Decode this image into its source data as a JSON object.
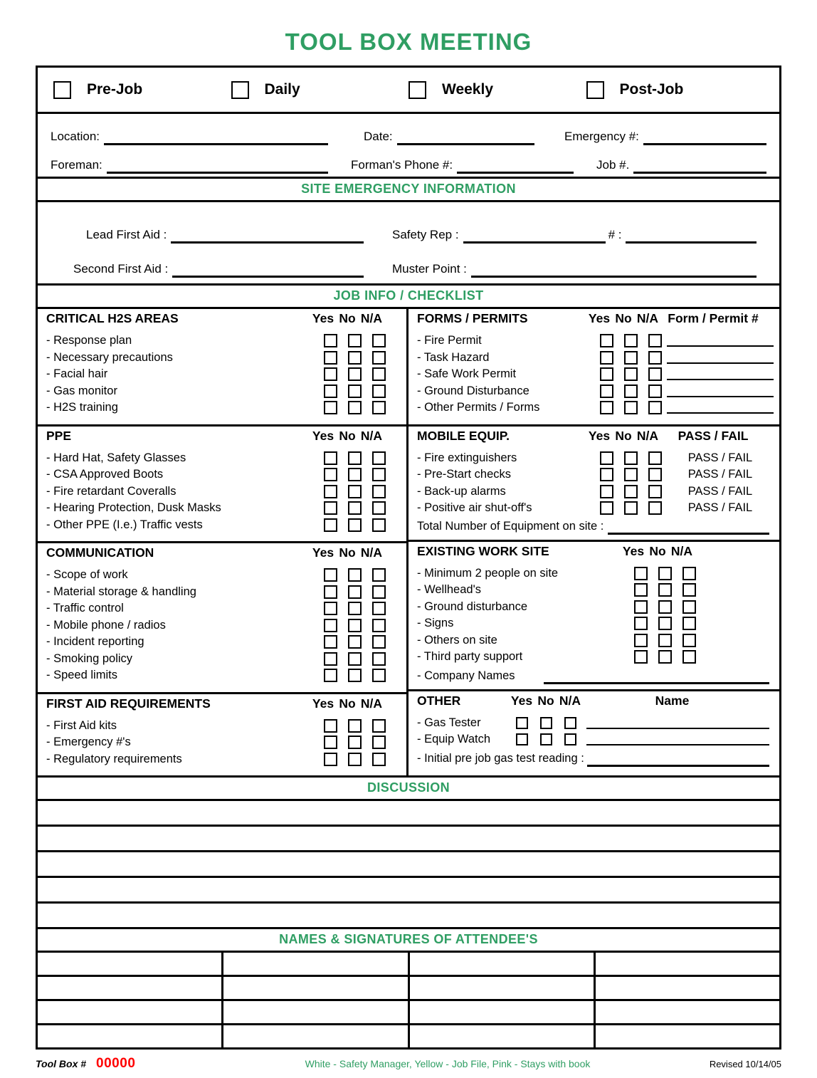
{
  "title": "TOOL BOX MEETING",
  "colors": {
    "green": "#2f9e63",
    "red": "#ff0000",
    "black": "#000000"
  },
  "meeting_types": [
    {
      "label": "Pre-Job"
    },
    {
      "label": "Daily"
    },
    {
      "label": "Weekly"
    },
    {
      "label": "Post-Job"
    }
  ],
  "header_fields": {
    "row1": [
      {
        "label": "Location:"
      },
      {
        "label": "Date:"
      },
      {
        "label": "Emergency #:"
      }
    ],
    "row2": [
      {
        "label": "Foreman:"
      },
      {
        "label": "Forman's Phone #:"
      },
      {
        "label": "Job #."
      }
    ]
  },
  "site_emergency": {
    "banner": "SITE EMERGENCY INFORMATION",
    "row1": [
      {
        "label": "Lead First Aid :"
      },
      {
        "label": "Safety Rep  :"
      },
      {
        "label": "# :"
      }
    ],
    "row2": [
      {
        "label": "Second First Aid :"
      },
      {
        "label": "Muster Point :"
      }
    ]
  },
  "job_info": {
    "banner": "JOB INFO / CHECKLIST",
    "yna": [
      "Yes",
      "No",
      "N/A"
    ],
    "left_sections": [
      {
        "heading": "CRITICAL H2S AREAS",
        "items": [
          "- Response plan",
          "- Necessary precautions",
          "- Facial hair",
          "- Gas monitor",
          "- H2S training"
        ]
      },
      {
        "heading": "PPE",
        "items": [
          "- Hard Hat, Safety Glasses",
          "- CSA Approved Boots",
          "- Fire retardant Coveralls",
          "- Hearing Protection, Dusk Masks",
          "- Other PPE (I.e.) Traffic vests"
        ]
      },
      {
        "heading": "COMMUNICATION",
        "items": [
          "- Scope of work",
          "- Material storage & handling",
          "- Traffic control",
          "- Mobile phone / radios",
          "- Incident reporting",
          "- Smoking policy",
          "- Speed limits"
        ]
      },
      {
        "heading": "FIRST AID REQUIREMENTS",
        "items": [
          "- First Aid kits",
          "- Emergency #'s",
          "- Regulatory requirements"
        ]
      }
    ],
    "right_sections": [
      {
        "heading": "FORMS / PERMITS",
        "extra_header": "Form / Permit #",
        "items": [
          "- Fire Permit",
          "- Task Hazard",
          "- Safe Work Permit",
          "- Ground Disturbance",
          "- Other Permits / Forms"
        ]
      },
      {
        "heading": "MOBILE EQUIP.",
        "extra_header": "PASS / FAIL",
        "items": [
          "- Fire extinguishers",
          "- Pre-Start checks",
          "- Back-up alarms",
          "- Positive air shut-off's"
        ],
        "pass_fail_label": "PASS / FAIL",
        "total_label": "Total Number of Equipment on site :"
      },
      {
        "heading": "EXISTING WORK SITE",
        "extra_header": "",
        "items": [
          "- Minimum 2 people on site",
          "- Wellhead's",
          "- Ground disturbance",
          "- Signs",
          "- Others on site",
          "- Third party support"
        ],
        "last_item": "- Company Names"
      },
      {
        "heading": "OTHER",
        "extra_header": "Name",
        "items": [
          "- Gas Tester",
          "- Equip Watch"
        ],
        "reading_label": "- Initial pre job gas test reading :"
      }
    ]
  },
  "discussion": {
    "banner": "DISCUSSION",
    "rows": 5
  },
  "signatures": {
    "banner": "NAMES & SIGNATURES OF ATTENDEE'S",
    "rows": 4,
    "cols": 4
  },
  "footer": {
    "tool_box_label": "Tool Box #",
    "tool_box_number": "00000",
    "distribution": "White - Safety Manager, Yellow - Job File, Pink - Stays with book",
    "revised": "Revised 10/14/05"
  }
}
